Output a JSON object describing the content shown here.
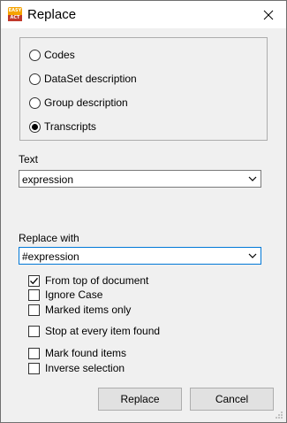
{
  "window": {
    "title": "Replace"
  },
  "app_icon": {
    "top_text": "EASY",
    "bottom_text": "ACT"
  },
  "scope": {
    "options": [
      {
        "label": "Codes",
        "checked": false
      },
      {
        "label": "DataSet description",
        "checked": false
      },
      {
        "label": "Group description",
        "checked": false
      },
      {
        "label": "Transcripts",
        "checked": true
      }
    ]
  },
  "text_field": {
    "label": "Text",
    "value": "expression"
  },
  "replace_field": {
    "label": "Replace with",
    "value": "#expression"
  },
  "options": [
    {
      "label": "From top of document",
      "checked": true
    },
    {
      "label": "Ignore Case",
      "checked": false
    },
    {
      "label": "Marked items only",
      "checked": false
    },
    {
      "label": "Stop at every item found",
      "checked": false
    },
    {
      "label": "Mark found items",
      "checked": false
    },
    {
      "label": "Inverse selection",
      "checked": false
    }
  ],
  "buttons": {
    "replace": "Replace",
    "cancel": "Cancel"
  }
}
